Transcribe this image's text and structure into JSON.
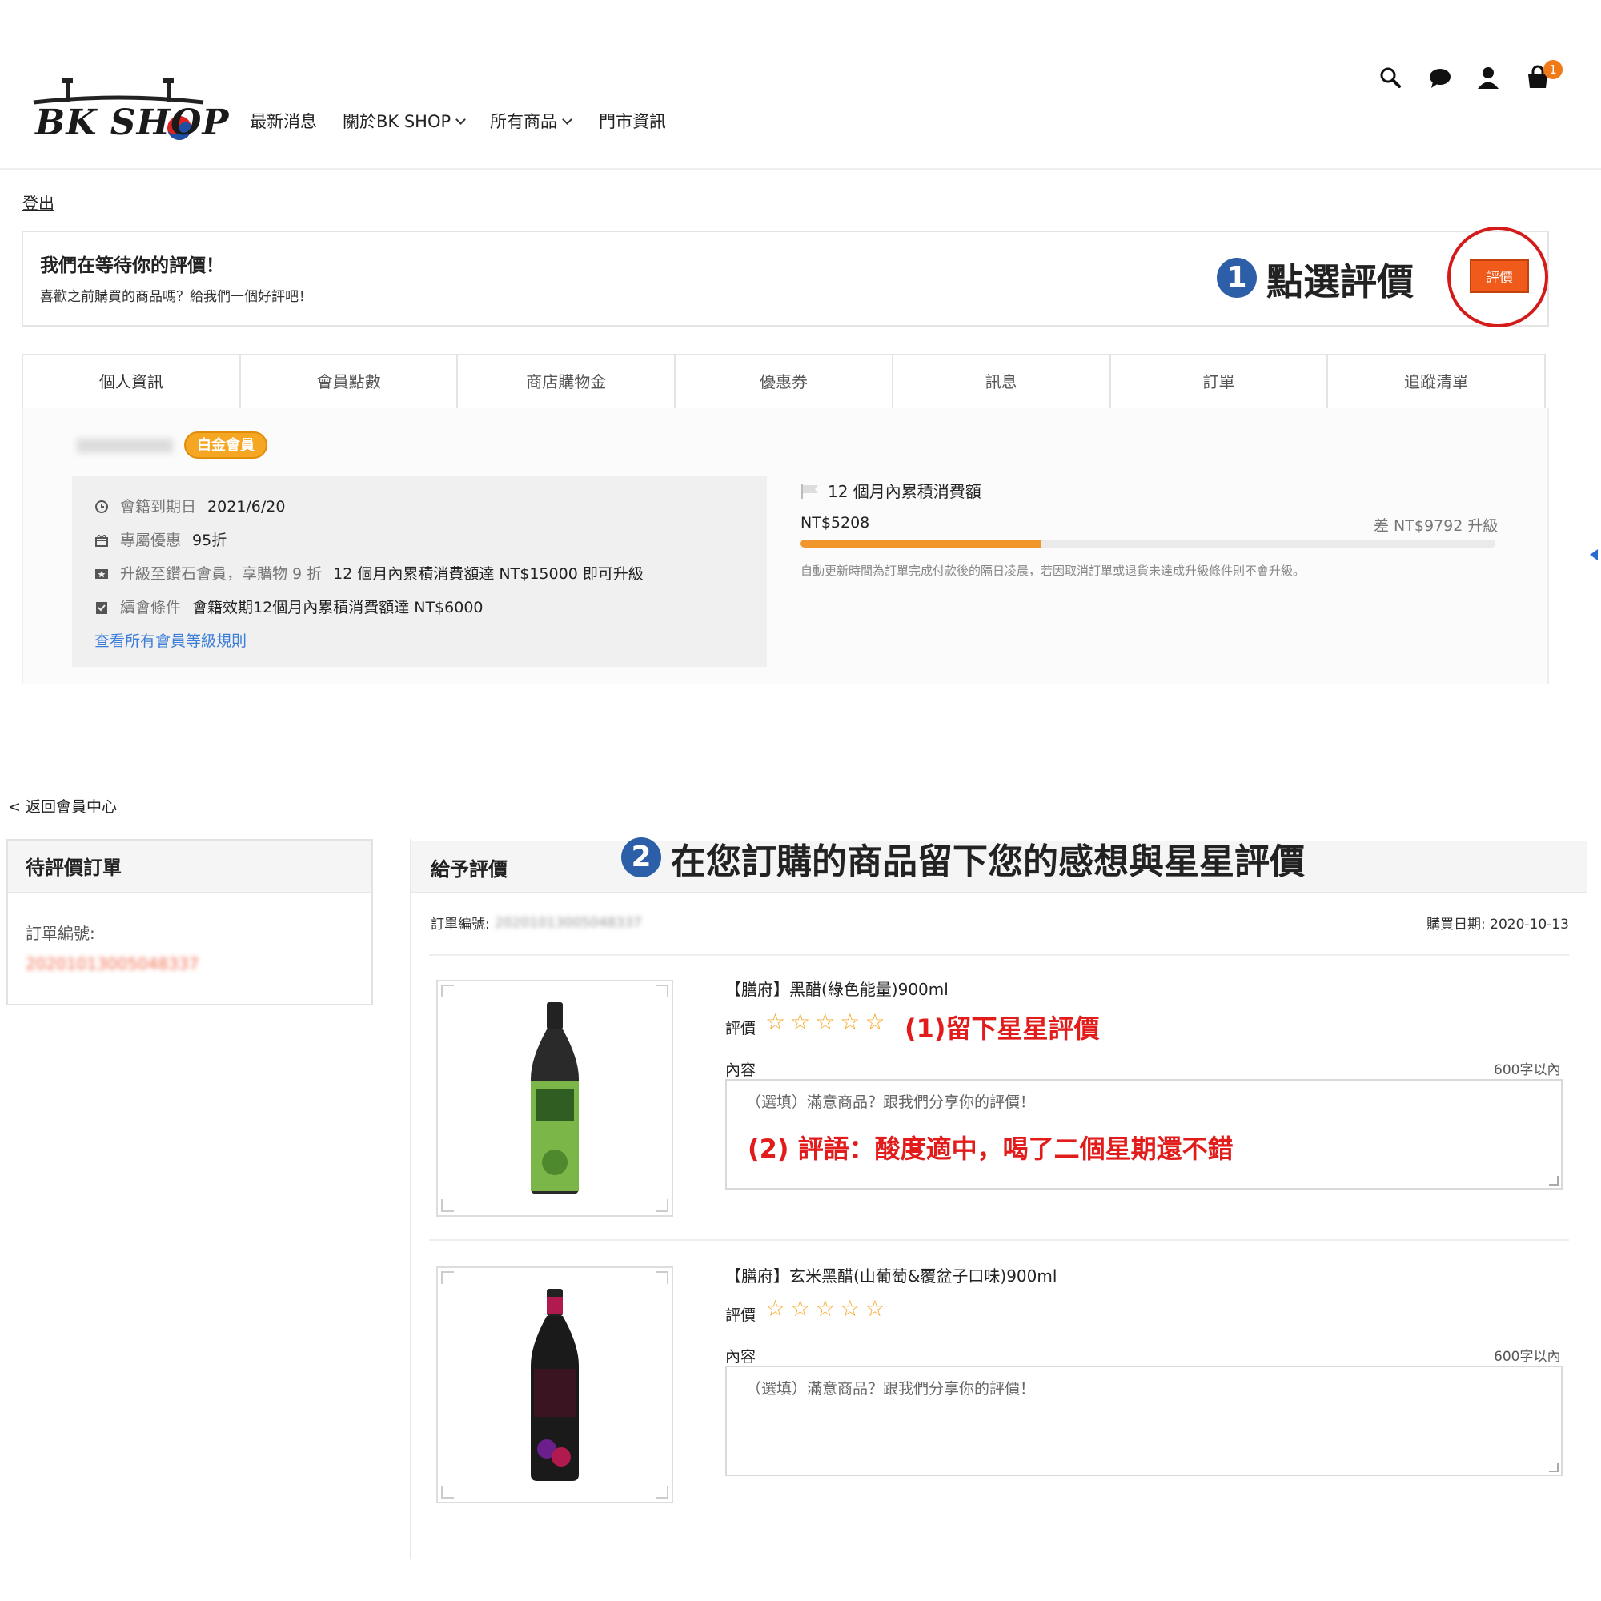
{
  "header": {
    "logo_text": "BK SHOP",
    "nav": [
      "最新消息",
      "關於BK SHOP",
      "所有商品",
      "門市資訊"
    ],
    "cart_count": "1",
    "icons": [
      "search-icon",
      "chat-icon",
      "user-icon",
      "cart-icon"
    ]
  },
  "member": {
    "logout": "登出",
    "banner_title": "我們在等待你的評價！",
    "banner_sub": "喜歡之前購買的商品嗎？給我們一個好評吧！",
    "step1_number": "1",
    "step1_text": "點選評價",
    "review_button": "評價",
    "tabs": [
      "個人資訊",
      "會員點數",
      "商店購物金",
      "優惠券",
      "訊息",
      "訂單",
      "追蹤清單"
    ],
    "username": "zoe0314",
    "tier": "白金會員",
    "info": [
      {
        "label": "會籍到期日",
        "value": "2021/6/20"
      },
      {
        "label": "專屬優惠",
        "value": "95折"
      },
      {
        "label": "升級至鑽石會員，享購物 9 折",
        "value": "12 個月內累積消費額達 NT$15000 即可升級"
      },
      {
        "label": "續會條件",
        "value": "會籍效期12個月內累積消費額達 NT$6000"
      }
    ],
    "rules_link": "查看所有會員等級規則",
    "spend_title": "12 個月內累積消費額",
    "spend_current": "NT$5208",
    "spend_diff": "差 NT$9792 升級",
    "spend_progress": 0.347,
    "spend_note": "自動更新時間為訂單完成付款後的隔日凌晨，若因取消訂單或退貨未達成升級條件則不會升級。",
    "colors": {
      "accent": "#f05a1a",
      "tier": "#f5a623",
      "progress": "#f0962a",
      "link": "#3b7dd8"
    }
  },
  "review": {
    "back_link": "< 返回會員中心",
    "pending_title": "待評價訂單",
    "order_no_label": "訂單編號:",
    "order_no_value": "20201013005048337",
    "give_title": "給予評價",
    "step2_number": "2",
    "step2_text": "在您訂購的商品留下您的感想與星星評價",
    "order_label": "訂單編號:",
    "buy_date": "購買日期: 2020-10-13",
    "rating_label": "評價",
    "content_label": "內容",
    "limit": "600字以內",
    "placeholder": "（選填）滿意商品？跟我們分享你的評價！",
    "star_count": 5,
    "products": [
      {
        "name": "【膳府】黑醋(綠色能量)900ml",
        "stars": "☆☆☆☆☆",
        "annotation_stars": "(1)留下星星評價",
        "annotation_comment": "(2) 評語：酸度適中，喝了二個星期還不錯",
        "bottle_color": "#7ab648"
      },
      {
        "name": "【膳府】玄米黑醋(山葡萄&覆盆子口味)900ml",
        "stars": "☆☆☆☆☆",
        "bottle_color": "#b11a4e"
      }
    ]
  }
}
